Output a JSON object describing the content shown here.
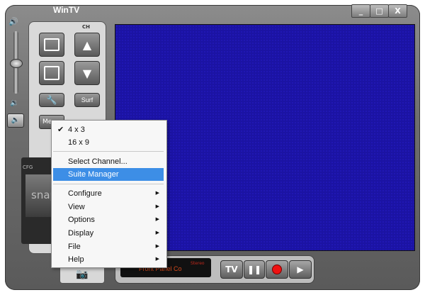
{
  "window": {
    "title": "WinTV",
    "controls": {
      "minimize": "_",
      "maximize": "□",
      "close": "X"
    }
  },
  "controls": {
    "ch_label": "CH",
    "surf_label": "Surf",
    "menu_label": "Me",
    "cfg_label": "CFG",
    "snap_label": "snap"
  },
  "status": {
    "source_text": "Front Panel Co",
    "stereo_text": "Stereo"
  },
  "transport": {
    "tv_label": "TV"
  },
  "context_menu": {
    "items": [
      {
        "label": "4 x 3",
        "checked": true
      },
      {
        "label": "16 x 9"
      },
      {
        "label": "Select Channel..."
      },
      {
        "label": "Suite Manager",
        "highlighted": true
      },
      {
        "label": "Configure",
        "submenu": true
      },
      {
        "label": "View",
        "submenu": true
      },
      {
        "label": "Options",
        "submenu": true
      },
      {
        "label": "Display",
        "submenu": true
      },
      {
        "label": "File",
        "submenu": true
      },
      {
        "label": "Help",
        "submenu": true
      }
    ]
  },
  "colors": {
    "video_bg": "#1b13a3",
    "menu_highlight": "#3d8ee6",
    "record": "#e11111",
    "lcd_text": "#d24a1b"
  }
}
